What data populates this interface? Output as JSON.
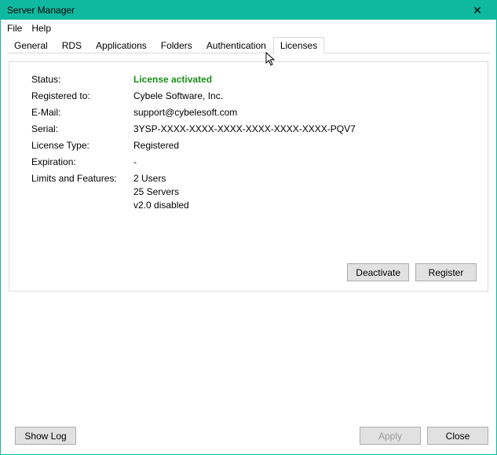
{
  "window": {
    "title": "Server Manager"
  },
  "menubar": {
    "file": "File",
    "help": "Help"
  },
  "tabs": {
    "general": "General",
    "rds": "RDS",
    "applications": "Applications",
    "folders": "Folders",
    "authentication": "Authentication",
    "licenses": "Licenses"
  },
  "license": {
    "labels": {
      "status": "Status:",
      "registered_to": "Registered to:",
      "email": "E-Mail:",
      "serial": "Serial:",
      "type": "License Type:",
      "expiration": "Expiration:",
      "limits": "Limits and Features:"
    },
    "values": {
      "status": "License activated",
      "registered_to": "Cybele Software, Inc.",
      "email": "support@cybelesoft.com",
      "serial": "3YSP-XXXX-XXXX-XXXX-XXXX-XXXX-XXXX-PQV7",
      "type": "Registered",
      "expiration": "-",
      "limits_users": "2 Users",
      "limits_servers": "25 Servers",
      "limits_v2": "v2.0 disabled"
    }
  },
  "buttons": {
    "deactivate": "Deactivate",
    "register": "Register",
    "show_log": "Show Log",
    "apply": "Apply",
    "close": "Close"
  }
}
